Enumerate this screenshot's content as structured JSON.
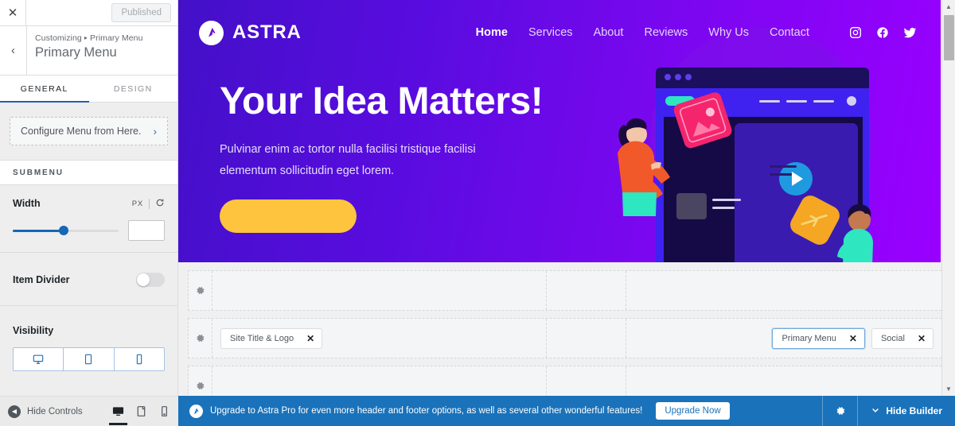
{
  "sidebar": {
    "close_label": "✕",
    "published_label": "Published",
    "back_label": "‹",
    "breadcrumb_root": "Customizing",
    "breadcrumb_sep": "▸",
    "breadcrumb_current": "Primary Menu",
    "panel_title": "Primary Menu",
    "tabs": [
      {
        "label": "GENERAL",
        "active": true
      },
      {
        "label": "DESIGN",
        "active": false
      }
    ],
    "configure_label": "Configure Menu from Here.",
    "configure_chevron": "›",
    "submenu_heading": "SUBMENU",
    "width": {
      "label": "Width",
      "unit": "PX",
      "reset_icon": "↺",
      "value": "",
      "placeholder": "",
      "slider_percent": 48
    },
    "item_divider": {
      "label": "Item Divider",
      "state": "off"
    },
    "visibility": {
      "label": "Visibility",
      "options": [
        "desktop",
        "tablet",
        "mobile"
      ]
    },
    "footer": {
      "hide_controls_label": "Hide Controls",
      "devices": [
        "desktop",
        "tablet",
        "mobile"
      ],
      "active_device": "desktop"
    }
  },
  "preview": {
    "brand": {
      "name": "ASTRA",
      "logo_icon": "astra-logo-icon"
    },
    "nav": [
      {
        "label": "Home",
        "active": true
      },
      {
        "label": "Services",
        "active": false
      },
      {
        "label": "About",
        "active": false
      },
      {
        "label": "Reviews",
        "active": false
      },
      {
        "label": "Why Us",
        "active": false
      },
      {
        "label": "Contact",
        "active": false
      }
    ],
    "social": [
      "instagram",
      "facebook",
      "twitter"
    ],
    "hero": {
      "title": "Your Idea Matters!",
      "subtitle_line1": "Pulvinar enim ac tortor nulla facilisi tristique facilisi",
      "subtitle_line2": "elementum sollicitudin eget lorem.",
      "button_color": "#ffc43d"
    },
    "colors": {
      "gradient_start": "#4310c8",
      "gradient_end": "#9900ff",
      "accent_blue": "#1a72ba"
    }
  },
  "builder": {
    "rows": [
      {
        "gear_icon": "gear-icon",
        "items": []
      },
      {
        "gear_icon": "gear-icon",
        "items": [
          {
            "label": "Site Title & Logo",
            "zone": "left",
            "selected": false,
            "remove_icon": "✕"
          }
        ]
      },
      {
        "gear_icon": "gear-icon",
        "items": []
      }
    ],
    "right_items": [
      {
        "label": "Primary Menu",
        "selected": true,
        "remove_icon": "✕"
      },
      {
        "label": "Social",
        "selected": false,
        "remove_icon": "✕"
      }
    ]
  },
  "bottom_bar": {
    "badge_icon": "astra-logo-icon",
    "upgrade_text": "Upgrade to Astra Pro for even more header and footer options, as well as several other wonderful features!",
    "upgrade_button": "Upgrade Now",
    "gear_icon": "gear-icon",
    "hide_builder_label": "Hide Builder",
    "hide_builder_chevron": "⌄"
  },
  "scrollbar": {
    "up_arrow": "▲",
    "down_arrow": "▼"
  }
}
